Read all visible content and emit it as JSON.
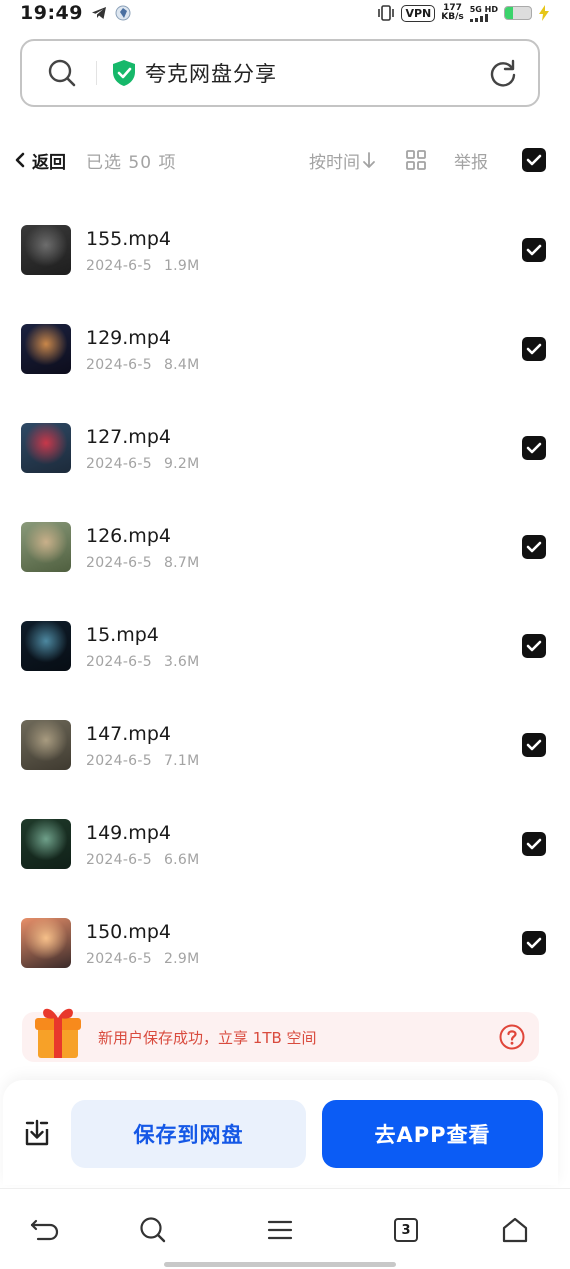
{
  "status_bar": {
    "time": "19:49",
    "vpn": "VPN",
    "speed_value": "177",
    "speed_unit": "KB/s",
    "network": "5G HD",
    "battery_level": 0.3
  },
  "search": {
    "text": "夸克网盘分享"
  },
  "toolbar": {
    "back_label": "返回",
    "selected_count": "已选 50 项",
    "sort_label": "按时间",
    "report_label": "举报"
  },
  "files": [
    {
      "name": "155.mp4",
      "date": "2024-6-5",
      "size": "1.9M",
      "thumb_colors": [
        "#3a3a3a",
        "#6d6d6d",
        "#1e1e1e"
      ]
    },
    {
      "name": "129.mp4",
      "date": "2024-6-5",
      "size": "8.4M",
      "thumb_colors": [
        "#1b2240",
        "#c9874a",
        "#0d0d1c"
      ]
    },
    {
      "name": "127.mp4",
      "date": "2024-6-5",
      "size": "9.2M",
      "thumb_colors": [
        "#2f4a66",
        "#c8384a",
        "#1c2a3a"
      ]
    },
    {
      "name": "126.mp4",
      "date": "2024-6-5",
      "size": "8.7M",
      "thumb_colors": [
        "#8a9a7a",
        "#c9b08a",
        "#4f5f3f"
      ]
    },
    {
      "name": "15.mp4",
      "date": "2024-6-5",
      "size": "3.6M",
      "thumb_colors": [
        "#0f1d2a",
        "#4d88a0",
        "#070d14"
      ]
    },
    {
      "name": "147.mp4",
      "date": "2024-6-5",
      "size": "7.1M",
      "thumb_colors": [
        "#6f6a5a",
        "#a89b80",
        "#3f3a30"
      ]
    },
    {
      "name": "149.mp4",
      "date": "2024-6-5",
      "size": "6.6M",
      "thumb_colors": [
        "#1f3a2a",
        "#6fa08a",
        "#102018"
      ]
    },
    {
      "name": "150.mp4",
      "date": "2024-6-5",
      "size": "2.9M",
      "thumb_colors": [
        "#e8906a",
        "#f6c08a",
        "#3a2a2a"
      ]
    }
  ],
  "promo": {
    "text": "新用户保存成功，立享 1TB 空间"
  },
  "actions": {
    "save_label": "保存到网盘",
    "app_label": "去APP查看"
  },
  "nav": {
    "tab_count": "3"
  },
  "colors": {
    "accent_blue": "#0b5cf5",
    "save_bg": "#eaf1fc",
    "promo_text": "#d94b3e",
    "shield_green": "#16b86a"
  },
  "icons": [
    "search-icon",
    "shield-check-icon",
    "refresh-icon",
    "chevron-left-icon",
    "arrow-down-icon",
    "grid-icon",
    "checkbox-checked-icon",
    "gift-icon",
    "help-icon",
    "download-icon",
    "back-arrow-icon",
    "menu-icon",
    "tabs-icon",
    "home-icon"
  ]
}
